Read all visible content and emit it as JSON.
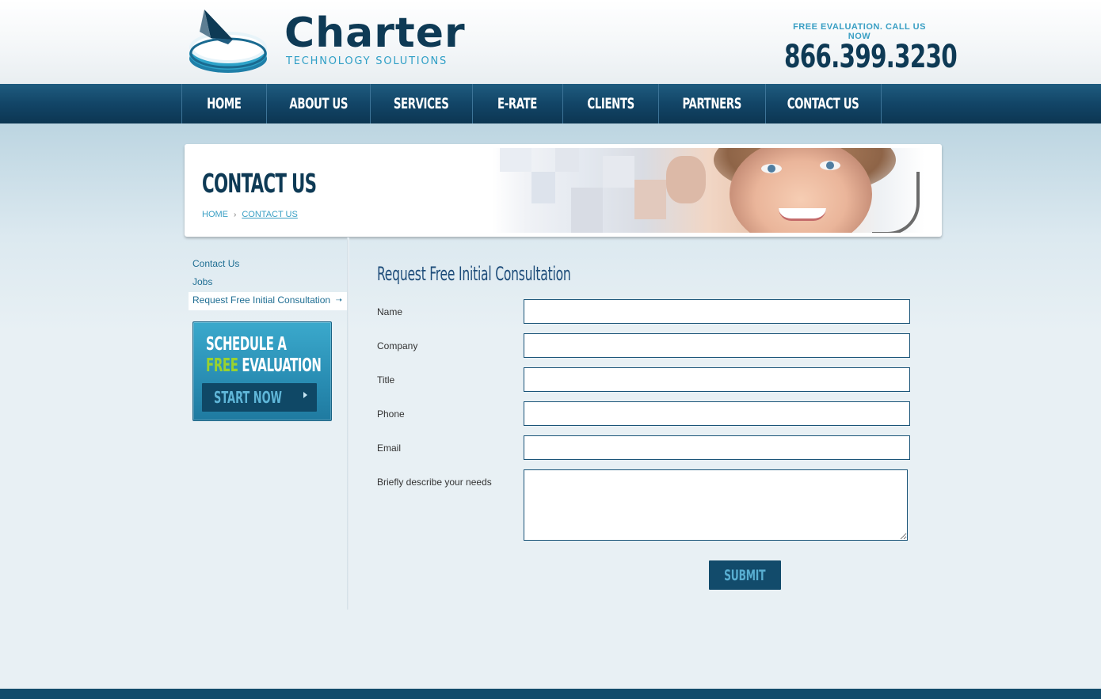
{
  "header": {
    "logo_word": "Charter",
    "logo_subtitle": "TECHNOLOGY SOLUTIONS",
    "cta_text": "FREE EVALUATION. CALL US NOW",
    "phone": "866.399.3230"
  },
  "nav": {
    "items": [
      {
        "label": "HOME"
      },
      {
        "label": "ABOUT US"
      },
      {
        "label": "SERVICES"
      },
      {
        "label": "E-RATE"
      },
      {
        "label": "CLIENTS"
      },
      {
        "label": "PARTNERS"
      },
      {
        "label": "CONTACT US"
      }
    ]
  },
  "banner": {
    "title": "CONTACT US",
    "breadcrumb": {
      "home": "HOME",
      "separator": "›",
      "current": "CONTACT US"
    }
  },
  "sidebar": {
    "links": [
      {
        "label": "Contact Us"
      },
      {
        "label": "Jobs"
      },
      {
        "label": "Request Free Initial Consultation",
        "active": true
      }
    ],
    "active_arrow": "➝",
    "promo": {
      "line1": "SCHEDULE A",
      "line2_highlight": "FREE",
      "line2_rest": " EVALUATION",
      "button_label": "START NOW"
    }
  },
  "form": {
    "title": "Request Free Initial Consultation",
    "fields": {
      "name": {
        "label": "Name",
        "value": ""
      },
      "company": {
        "label": "Company",
        "value": ""
      },
      "title": {
        "label": "Title",
        "value": ""
      },
      "phone": {
        "label": "Phone",
        "value": ""
      },
      "email": {
        "label": "Email",
        "value": ""
      },
      "needs": {
        "label": "Briefly describe your needs",
        "value": ""
      }
    },
    "submit_label": "SUBMIT"
  },
  "colors": {
    "brand_dark": "#0e3a55",
    "brand_accent": "#3a9fc4",
    "nav_bg": "#124567",
    "highlight_green": "#9ad22f"
  }
}
